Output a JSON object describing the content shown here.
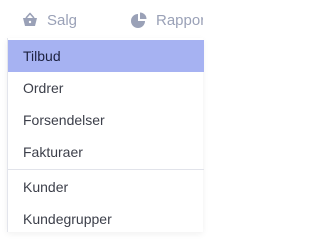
{
  "topnav": {
    "items": [
      {
        "label": "Salg",
        "icon": "basket-icon"
      },
      {
        "label": "Rapportering",
        "icon": "pie-chart-icon"
      }
    ],
    "text_color": "#9aa1b7"
  },
  "dropdown": {
    "groups": [
      {
        "items": [
          {
            "label": "Tilbud",
            "active": true
          },
          {
            "label": "Ordrer",
            "active": false
          },
          {
            "label": "Forsendelser",
            "active": false
          },
          {
            "label": "Fakturaer",
            "active": false
          }
        ]
      },
      {
        "items": [
          {
            "label": "Kunder",
            "active": false
          },
          {
            "label": "Kundegrupper",
            "active": false
          }
        ]
      }
    ],
    "active_color": "#a6b2f2"
  }
}
